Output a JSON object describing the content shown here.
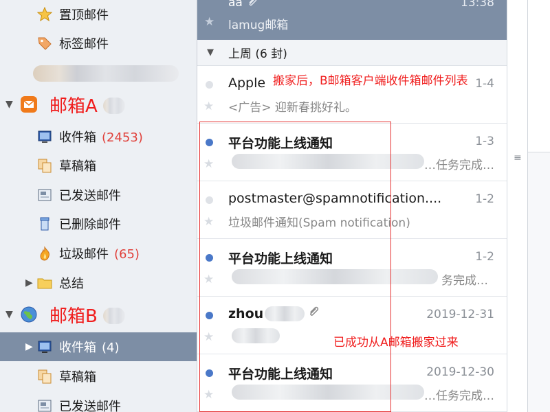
{
  "sidebar": {
    "pinned": "置顶邮件",
    "tagged": "标签邮件",
    "account_a": {
      "name": "邮箱A",
      "folders": [
        {
          "label": "收件箱",
          "count": "(2453)"
        },
        {
          "label": "草稿箱",
          "count": ""
        },
        {
          "label": "已发送邮件",
          "count": ""
        },
        {
          "label": "已删除邮件",
          "count": ""
        },
        {
          "label": "垃圾邮件",
          "count": "(65)"
        },
        {
          "label": "总结",
          "count": ""
        }
      ]
    },
    "account_b": {
      "name": "邮箱B",
      "folders": [
        {
          "label": "收件箱",
          "count": "(4)"
        },
        {
          "label": "草稿箱",
          "count": ""
        },
        {
          "label": "已发送邮件",
          "count": ""
        }
      ]
    }
  },
  "mail_list": {
    "top_item": {
      "sender": "aa",
      "date": "13:38",
      "subject": "lamug邮箱"
    },
    "group_header": "上周 (6 封)",
    "items": [
      {
        "sender": "Apple",
        "date": "1-4",
        "subject": "<广告> 迎新春挑好礼。",
        "unread": false
      },
      {
        "sender": "平台功能上线通知",
        "date": "1-3",
        "subject": "…任务完成…",
        "unread": true
      },
      {
        "sender": "postmaster@spamnotification....",
        "date": "1-2",
        "subject": "垃圾邮件通知(Spam notification)",
        "unread": false
      },
      {
        "sender": "平台功能上线通知",
        "date": "1-2",
        "subject": "务完成…",
        "unread": true
      },
      {
        "sender": "zhou",
        "date": "2019-12-31",
        "subject": "",
        "unread": true
      },
      {
        "sender": "平台功能上线通知",
        "date": "2019-12-30",
        "subject": "…任务完成…",
        "unread": true
      }
    ]
  },
  "annotations": {
    "top": "搬家后，B邮箱客户端收件箱邮件列表",
    "bottom": "已成功从A邮箱搬家过来"
  },
  "colors": {
    "accent": "#7d8ea5",
    "annotation": "#f01d1d",
    "unread_dot": "#4a78c8"
  }
}
